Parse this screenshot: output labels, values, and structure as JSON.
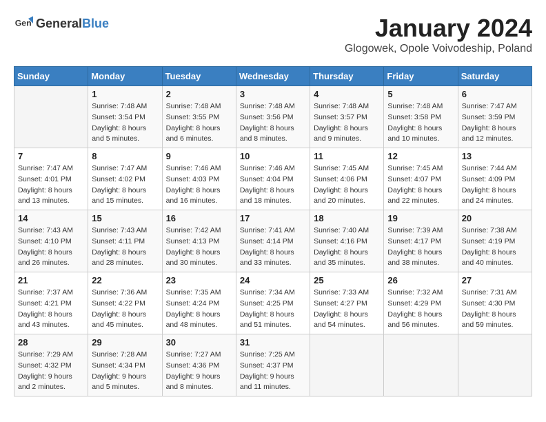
{
  "logo": {
    "general": "General",
    "blue": "Blue"
  },
  "title": "January 2024",
  "subtitle": "Glogowek, Opole Voivodeship, Poland",
  "weekdays": [
    "Sunday",
    "Monday",
    "Tuesday",
    "Wednesday",
    "Thursday",
    "Friday",
    "Saturday"
  ],
  "weeks": [
    [
      {
        "day": "",
        "content": ""
      },
      {
        "day": "1",
        "content": "Sunrise: 7:48 AM\nSunset: 3:54 PM\nDaylight: 8 hours\nand 5 minutes."
      },
      {
        "day": "2",
        "content": "Sunrise: 7:48 AM\nSunset: 3:55 PM\nDaylight: 8 hours\nand 6 minutes."
      },
      {
        "day": "3",
        "content": "Sunrise: 7:48 AM\nSunset: 3:56 PM\nDaylight: 8 hours\nand 8 minutes."
      },
      {
        "day": "4",
        "content": "Sunrise: 7:48 AM\nSunset: 3:57 PM\nDaylight: 8 hours\nand 9 minutes."
      },
      {
        "day": "5",
        "content": "Sunrise: 7:48 AM\nSunset: 3:58 PM\nDaylight: 8 hours\nand 10 minutes."
      },
      {
        "day": "6",
        "content": "Sunrise: 7:47 AM\nSunset: 3:59 PM\nDaylight: 8 hours\nand 12 minutes."
      }
    ],
    [
      {
        "day": "7",
        "content": "Sunrise: 7:47 AM\nSunset: 4:01 PM\nDaylight: 8 hours\nand 13 minutes."
      },
      {
        "day": "8",
        "content": "Sunrise: 7:47 AM\nSunset: 4:02 PM\nDaylight: 8 hours\nand 15 minutes."
      },
      {
        "day": "9",
        "content": "Sunrise: 7:46 AM\nSunset: 4:03 PM\nDaylight: 8 hours\nand 16 minutes."
      },
      {
        "day": "10",
        "content": "Sunrise: 7:46 AM\nSunset: 4:04 PM\nDaylight: 8 hours\nand 18 minutes."
      },
      {
        "day": "11",
        "content": "Sunrise: 7:45 AM\nSunset: 4:06 PM\nDaylight: 8 hours\nand 20 minutes."
      },
      {
        "day": "12",
        "content": "Sunrise: 7:45 AM\nSunset: 4:07 PM\nDaylight: 8 hours\nand 22 minutes."
      },
      {
        "day": "13",
        "content": "Sunrise: 7:44 AM\nSunset: 4:09 PM\nDaylight: 8 hours\nand 24 minutes."
      }
    ],
    [
      {
        "day": "14",
        "content": "Sunrise: 7:43 AM\nSunset: 4:10 PM\nDaylight: 8 hours\nand 26 minutes."
      },
      {
        "day": "15",
        "content": "Sunrise: 7:43 AM\nSunset: 4:11 PM\nDaylight: 8 hours\nand 28 minutes."
      },
      {
        "day": "16",
        "content": "Sunrise: 7:42 AM\nSunset: 4:13 PM\nDaylight: 8 hours\nand 30 minutes."
      },
      {
        "day": "17",
        "content": "Sunrise: 7:41 AM\nSunset: 4:14 PM\nDaylight: 8 hours\nand 33 minutes."
      },
      {
        "day": "18",
        "content": "Sunrise: 7:40 AM\nSunset: 4:16 PM\nDaylight: 8 hours\nand 35 minutes."
      },
      {
        "day": "19",
        "content": "Sunrise: 7:39 AM\nSunset: 4:17 PM\nDaylight: 8 hours\nand 38 minutes."
      },
      {
        "day": "20",
        "content": "Sunrise: 7:38 AM\nSunset: 4:19 PM\nDaylight: 8 hours\nand 40 minutes."
      }
    ],
    [
      {
        "day": "21",
        "content": "Sunrise: 7:37 AM\nSunset: 4:21 PM\nDaylight: 8 hours\nand 43 minutes."
      },
      {
        "day": "22",
        "content": "Sunrise: 7:36 AM\nSunset: 4:22 PM\nDaylight: 8 hours\nand 45 minutes."
      },
      {
        "day": "23",
        "content": "Sunrise: 7:35 AM\nSunset: 4:24 PM\nDaylight: 8 hours\nand 48 minutes."
      },
      {
        "day": "24",
        "content": "Sunrise: 7:34 AM\nSunset: 4:25 PM\nDaylight: 8 hours\nand 51 minutes."
      },
      {
        "day": "25",
        "content": "Sunrise: 7:33 AM\nSunset: 4:27 PM\nDaylight: 8 hours\nand 54 minutes."
      },
      {
        "day": "26",
        "content": "Sunrise: 7:32 AM\nSunset: 4:29 PM\nDaylight: 8 hours\nand 56 minutes."
      },
      {
        "day": "27",
        "content": "Sunrise: 7:31 AM\nSunset: 4:30 PM\nDaylight: 8 hours\nand 59 minutes."
      }
    ],
    [
      {
        "day": "28",
        "content": "Sunrise: 7:29 AM\nSunset: 4:32 PM\nDaylight: 9 hours\nand 2 minutes."
      },
      {
        "day": "29",
        "content": "Sunrise: 7:28 AM\nSunset: 4:34 PM\nDaylight: 9 hours\nand 5 minutes."
      },
      {
        "day": "30",
        "content": "Sunrise: 7:27 AM\nSunset: 4:36 PM\nDaylight: 9 hours\nand 8 minutes."
      },
      {
        "day": "31",
        "content": "Sunrise: 7:25 AM\nSunset: 4:37 PM\nDaylight: 9 hours\nand 11 minutes."
      },
      {
        "day": "",
        "content": ""
      },
      {
        "day": "",
        "content": ""
      },
      {
        "day": "",
        "content": ""
      }
    ]
  ]
}
